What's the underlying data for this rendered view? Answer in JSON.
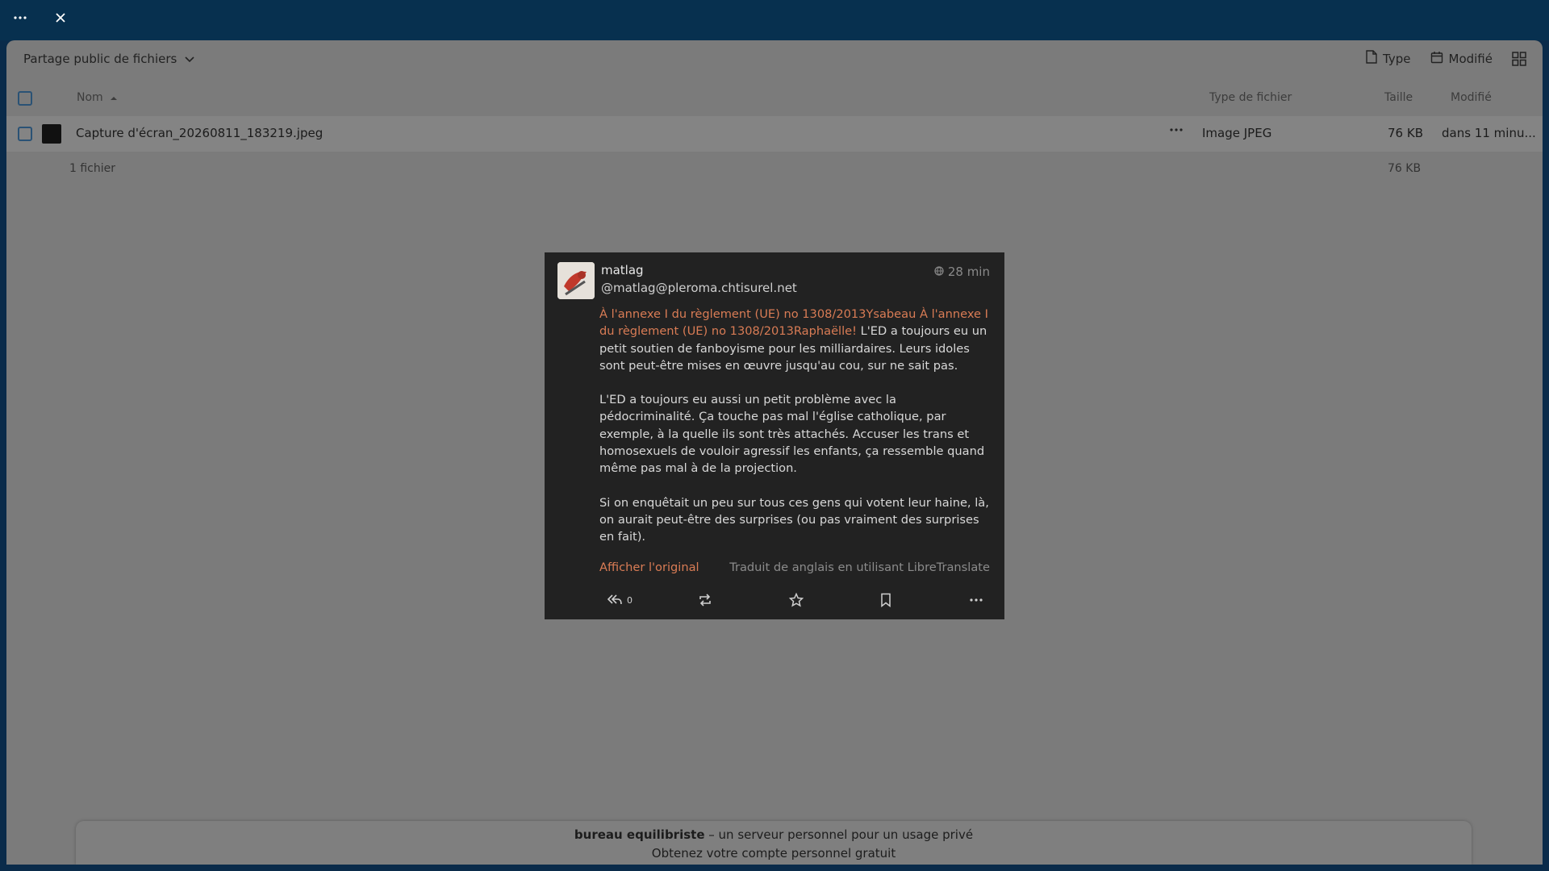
{
  "topbar": {
    "menu_icon": "more-horizontal-icon",
    "close_icon": "close-icon"
  },
  "header": {
    "breadcrumb": "Partage public de fichiers",
    "type_label": "Type",
    "modified_label": "Modifié"
  },
  "columns": {
    "name": "Nom",
    "file_type": "Type de fichier",
    "size": "Taille",
    "modified": "Modifié"
  },
  "files": [
    {
      "name": "Capture d'écran_20260811_183219.jpeg",
      "type": "Image JPEG",
      "size": "76 KB",
      "modified": "dans 11 minu..."
    }
  ],
  "summary": {
    "count": "1 fichier",
    "total_size": "76 KB"
  },
  "post": {
    "author": "matlag",
    "handle": "@matlag@pleroma.chtisurel.net",
    "time": "28 min",
    "mentions": "À l'annexe I du règlement (UE) no 1308/2013Ysabeau À l'annexe I du règlement (UE) no 1308/2013Raphaëlle!",
    "para1_rest": " L'ED a toujours eu un petit soutien de fanboyisme pour les milliardaires. Leurs idoles sont peut-être mises en œuvre jusqu'au cou, sur ne sait pas.",
    "para2": "L'ED a toujours eu aussi un petit problème avec la pédocriminalité. Ça touche pas mal l'église catholique, par exemple, à la quelle ils sont très attachés. Accuser les trans et homosexuels de vouloir agressif les enfants, ça ressemble quand même pas mal à de la projection.",
    "para3": "Si on enquêtait un peu sur tous ces gens qui votent leur haine, là, on aurait peut-être des surprises (ou pas vraiment des surprises en fait).",
    "show_original": "Afficher l'original",
    "translated_note": "Traduit de anglais en utilisant LibreTranslate",
    "reply_count": "0"
  },
  "banner": {
    "brand": "bureau equilibriste",
    "tagline": " – un serveur personnel pour un usage privé",
    "cta": "Obtenez votre compte personnel gratuit"
  }
}
